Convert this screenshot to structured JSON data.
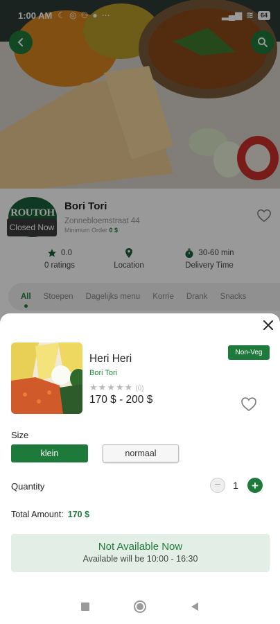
{
  "status_bar": {
    "time": "1:00 AM",
    "battery": "64"
  },
  "restaurant": {
    "logo_text": "ROUTOH",
    "closed_label": "Closed Now",
    "name": "Bori Tori",
    "address": "Zonnebloemstraat 44",
    "min_order_label": "Minimum Order",
    "min_order_value": "0 $",
    "rating_value": "0.0",
    "rating_label": "0 ratings",
    "location_label": "Location",
    "delivery_value": "30-60 min",
    "delivery_label": "Delivery Time"
  },
  "categories": [
    "All",
    "Stoepen",
    "Dagelijks menu",
    "Korrie",
    "Drank",
    "Snacks"
  ],
  "sheet": {
    "dish_name": "Heri Heri",
    "restaurant_name": "Bori Tori",
    "stars": "★★★★★",
    "review_count": "(0)",
    "price": "170 $ - 200 $",
    "badge": "Non-Veg",
    "size_label": "Size",
    "sizes": [
      "klein",
      "normaal"
    ],
    "selected_size": "klein",
    "quantity_label": "Quantity",
    "quantity": "1",
    "total_label": "Total Amount:",
    "total_value": "170 $",
    "na_title": "Not Available Now",
    "na_subtitle": "Available will be 10:00 - 16:30"
  },
  "colors": {
    "brand_green": "#1e7a3a",
    "light_green_bg": "#e3efe6"
  }
}
